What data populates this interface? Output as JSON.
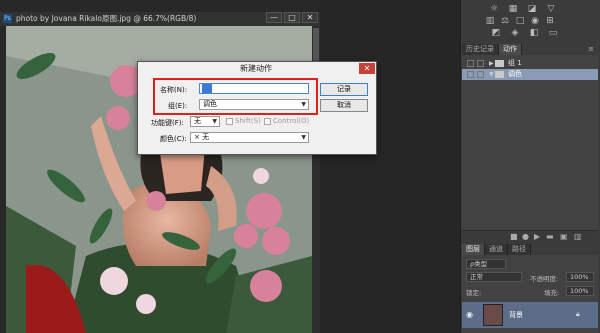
{
  "document": {
    "title": "photo by Jovana Rikalo原图.jpg @ 66.7%(RGB/8)",
    "controls": [
      "—",
      "□",
      "✕"
    ]
  },
  "right_panel": {
    "history_tabs": [
      "历史记录",
      "动作"
    ],
    "actions": [
      {
        "label": "组 1"
      },
      {
        "label": "调色"
      }
    ],
    "layers_tabs": [
      "图层",
      "通道",
      "路径"
    ],
    "filter_label": "ρ类型",
    "blend_mode": "正常",
    "opacity_label": "不透明度:",
    "opacity_value": "100%",
    "lock_label": "锁定:",
    "fill_label": "填充:",
    "fill_value": "100%",
    "layer_name": "背景"
  },
  "dialog": {
    "title": "新建动作",
    "name_label": "名称(N):",
    "name_value": "",
    "group_label": "组(E):",
    "group_value": "调色",
    "function_key_label": "功能键(F):",
    "function_key_value": "无",
    "shift_label": "Shift(S)",
    "control_label": "Control(O)",
    "color_label": "颜色(C):",
    "color_value": "× 无",
    "record_button": "记录",
    "cancel_button": "取消"
  },
  "colors": {
    "highlight_rect": "#e0201e",
    "selected_action": "#8a9bb5",
    "selected_layer": "#5b6d88"
  }
}
